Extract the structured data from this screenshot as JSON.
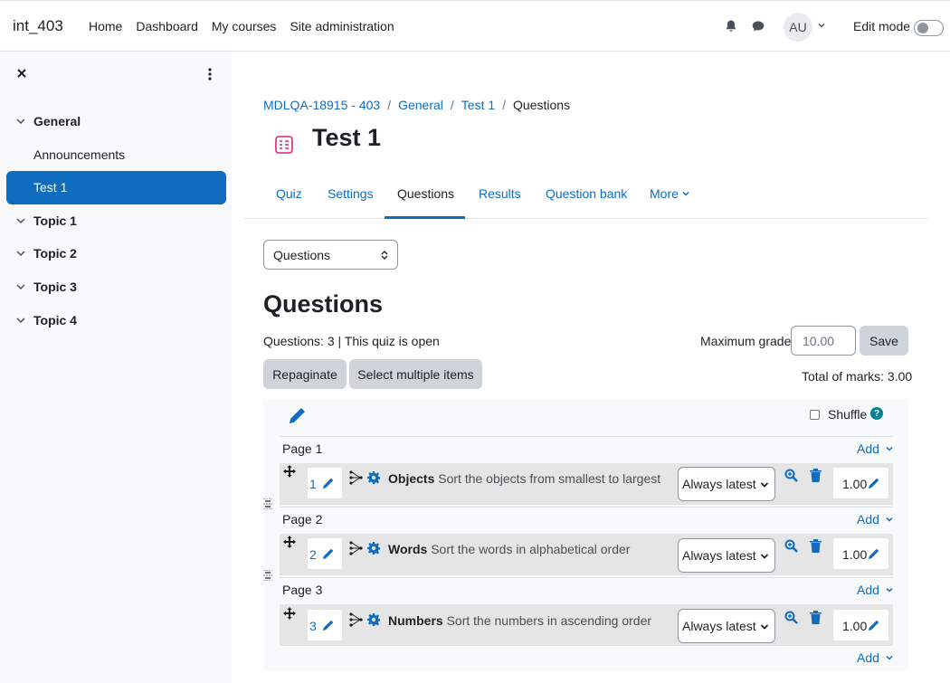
{
  "navbar": {
    "brand": "int_403",
    "links": [
      "Home",
      "Dashboard",
      "My courses",
      "Site administration"
    ],
    "avatar_initials": "AU",
    "edit_mode_label": "Edit mode",
    "edit_mode_on": false
  },
  "drawer": {
    "sections": [
      {
        "label": "General",
        "items": [
          "Announcements",
          "Test 1"
        ],
        "active_item": "Test 1"
      },
      {
        "label": "Topic 1"
      },
      {
        "label": "Topic 2"
      },
      {
        "label": "Topic 3"
      },
      {
        "label": "Topic 4"
      }
    ]
  },
  "breadcrumb": [
    "MDLQA-18915 - 403",
    "General",
    "Test 1",
    "Questions"
  ],
  "page_title": "Test 1",
  "tabs": [
    {
      "label": "Quiz"
    },
    {
      "label": "Settings"
    },
    {
      "label": "Questions",
      "active": true
    },
    {
      "label": "Results"
    },
    {
      "label": "Question bank"
    },
    {
      "label": "More"
    }
  ],
  "page_select": {
    "value": "Questions"
  },
  "heading": "Questions",
  "summary": "Questions: 3 | This quiz is open",
  "maximum_grade": {
    "label": "Maximum grade",
    "value": "10.00",
    "save_label": "Save"
  },
  "buttons": {
    "repaginate": "Repaginate",
    "select_multiple": "Select multiple items"
  },
  "total_marks": "Total of marks: 3.00",
  "shuffle": {
    "label": "Shuffle",
    "checked": false,
    "help": "?"
  },
  "add_label": "Add",
  "pages": [
    {
      "label": "Page 1",
      "question": {
        "slot": "1",
        "name": "Objects",
        "text": "Sort the objects from smallest to largest",
        "version": "Always latest",
        "mark": "1.00"
      }
    },
    {
      "label": "Page 2",
      "question": {
        "slot": "2",
        "name": "Words",
        "text": "Sort the words in alphabetical order",
        "version": "Always latest",
        "mark": "1.00"
      }
    },
    {
      "label": "Page 3",
      "question": {
        "slot": "3",
        "name": "Numbers",
        "text": "Sort the numbers in ascending order",
        "version": "Always latest",
        "mark": "1.00"
      }
    }
  ]
}
